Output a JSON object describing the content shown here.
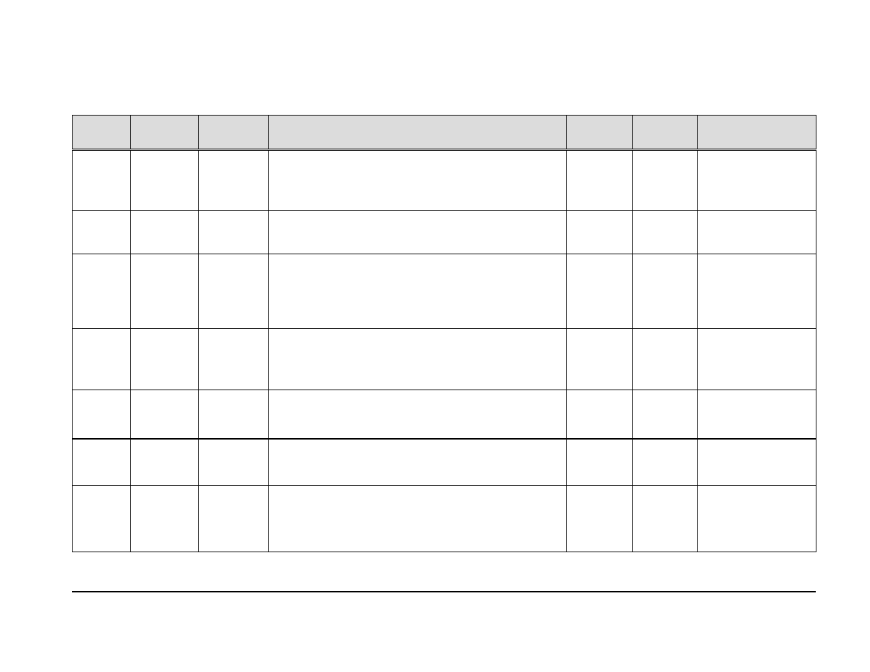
{
  "table": {
    "headers": [
      "",
      "",
      "",
      "",
      "",
      "",
      ""
    ],
    "rows": [
      [
        "",
        "",
        "",
        "",
        "",
        "",
        ""
      ],
      [
        "",
        "",
        "",
        "",
        "",
        "",
        ""
      ],
      [
        "",
        "",
        "",
        "",
        "",
        "",
        ""
      ],
      [
        "",
        "",
        "",
        "",
        "",
        "",
        ""
      ],
      [
        "",
        "",
        "",
        "",
        "",
        "",
        ""
      ],
      [
        "",
        "",
        "",
        "",
        "",
        "",
        ""
      ],
      [
        "",
        "",
        "",
        "",
        "",
        "",
        ""
      ]
    ]
  }
}
